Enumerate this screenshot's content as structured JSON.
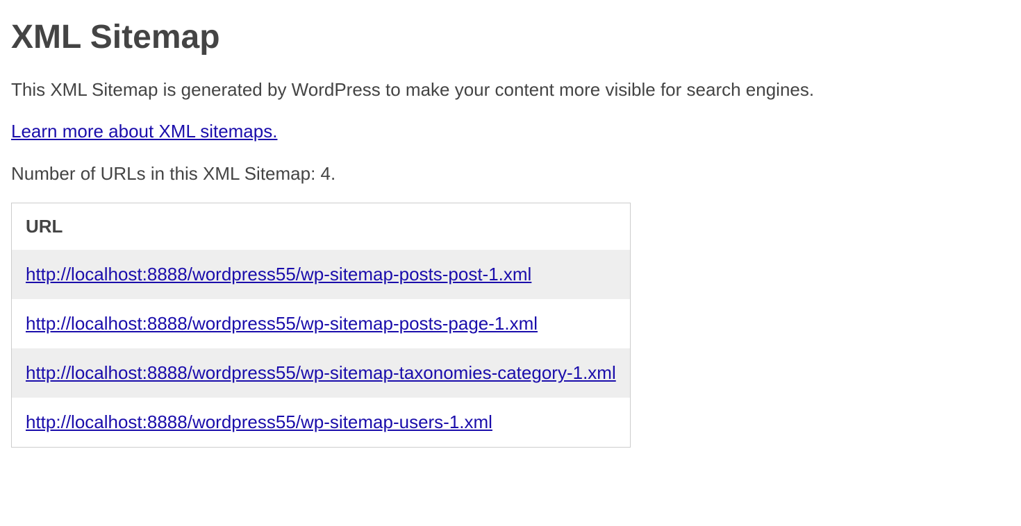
{
  "title": "XML Sitemap",
  "description": "This XML Sitemap is generated by WordPress to make your content more visible for search engines.",
  "learnMoreLink": "Learn more about XML sitemaps.",
  "countText": "Number of URLs in this XML Sitemap: 4.",
  "table": {
    "header": "URL",
    "rows": [
      "http://localhost:8888/wordpress55/wp-sitemap-posts-post-1.xml",
      "http://localhost:8888/wordpress55/wp-sitemap-posts-page-1.xml",
      "http://localhost:8888/wordpress55/wp-sitemap-taxonomies-category-1.xml",
      "http://localhost:8888/wordpress55/wp-sitemap-users-1.xml"
    ]
  }
}
